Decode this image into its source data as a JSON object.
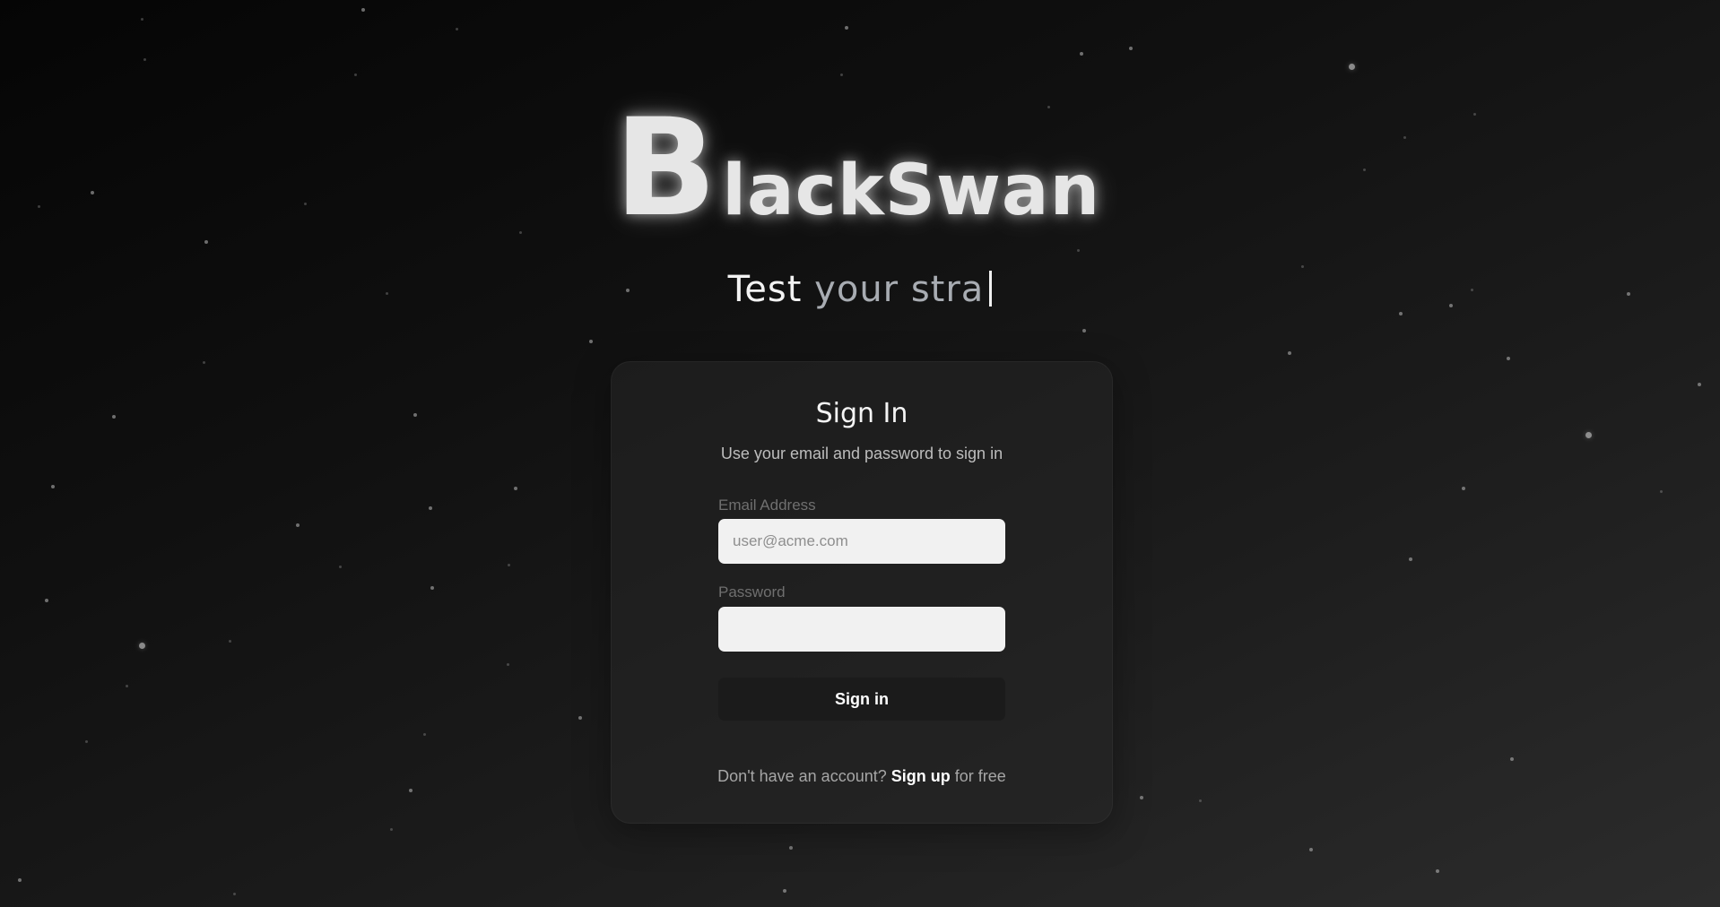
{
  "brand": {
    "logo_initial": "B",
    "logo_rest": "lackSwan"
  },
  "tagline": {
    "typed": "Test",
    "typing": "your stra"
  },
  "signin_card": {
    "title": "Sign In",
    "subtitle": "Use your email and password to sign in",
    "email_label": "Email Address",
    "email_placeholder": "user@acme.com",
    "email_value": "",
    "password_label": "Password",
    "password_value": "",
    "submit_label": "Sign in",
    "footer_prefix": "Don't have an account?",
    "footer_link": "Sign up",
    "footer_suffix": "for free"
  },
  "colors": {
    "background_dark": "#050505",
    "background_light": "#2c2c2c",
    "card": "#262626",
    "input": "#f1f1f1",
    "button": "#1b1b1b",
    "text_primary": "#f4f4f4",
    "text_muted": "#a6a6a6"
  }
}
